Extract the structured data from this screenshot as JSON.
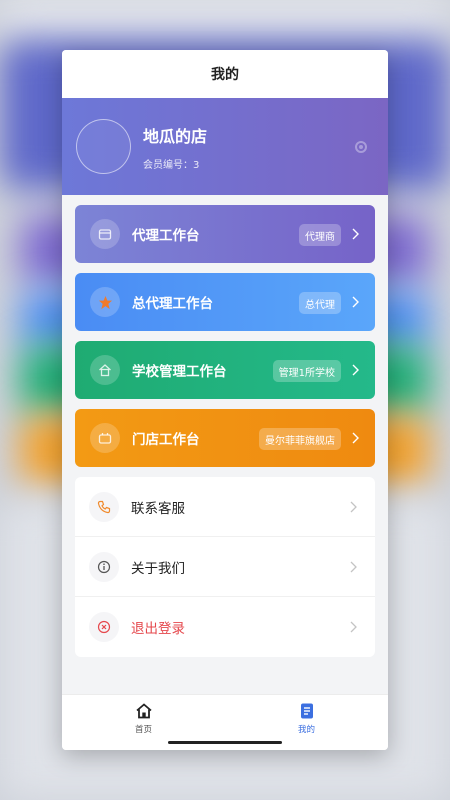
{
  "navbar": {
    "title": "我的"
  },
  "profile": {
    "name": "地瓜的店",
    "member_label": "会员编号：",
    "member_no": "3"
  },
  "cards": [
    {
      "title": "代理工作台",
      "badge": "代理商",
      "icon": "store-icon",
      "color": "#7a72d0"
    },
    {
      "title": "总代理工作台",
      "badge": "总代理",
      "icon": "star-icon",
      "color": "#4f95f6"
    },
    {
      "title": "学校管理工作台",
      "badge": "管理1所学校",
      "icon": "home-icon",
      "color": "#20b17d"
    },
    {
      "title": "门店工作台",
      "badge": "曼尔菲菲旗舰店",
      "icon": "shop-icon",
      "color": "#f19512"
    }
  ],
  "menu": [
    {
      "label": "联系客服",
      "icon": "phone-icon"
    },
    {
      "label": "关于我们",
      "icon": "info-icon"
    },
    {
      "label": "退出登录",
      "icon": "logout-icon"
    }
  ],
  "tabbar": [
    {
      "label": "首页",
      "icon": "home-tab-icon"
    },
    {
      "label": "我的",
      "icon": "profile-tab-icon",
      "active": true
    }
  ],
  "colors": {
    "accent": "#3c6fe0",
    "danger": "#e5484d"
  }
}
